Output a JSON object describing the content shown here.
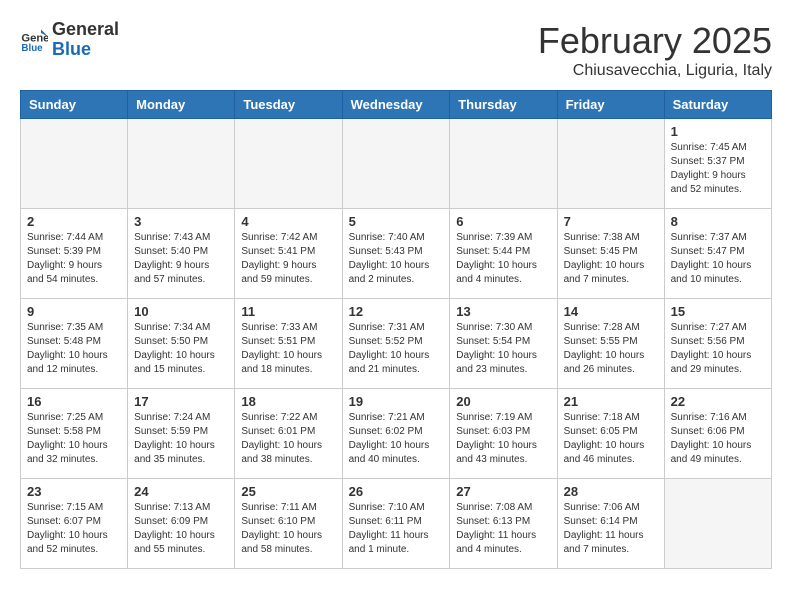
{
  "header": {
    "logo_line1": "General",
    "logo_line2": "Blue",
    "calendar_title": "February 2025",
    "calendar_subtitle": "Chiusavecchia, Liguria, Italy"
  },
  "weekdays": [
    "Sunday",
    "Monday",
    "Tuesday",
    "Wednesday",
    "Thursday",
    "Friday",
    "Saturday"
  ],
  "weeks": [
    [
      {
        "empty": true
      },
      {
        "empty": true
      },
      {
        "empty": true
      },
      {
        "empty": true
      },
      {
        "empty": true
      },
      {
        "empty": true
      },
      {
        "day": 1,
        "sunrise": "7:45 AM",
        "sunset": "5:37 PM",
        "daylight": "9 hours and 52 minutes."
      }
    ],
    [
      {
        "day": 2,
        "sunrise": "7:44 AM",
        "sunset": "5:39 PM",
        "daylight": "9 hours and 54 minutes."
      },
      {
        "day": 3,
        "sunrise": "7:43 AM",
        "sunset": "5:40 PM",
        "daylight": "9 hours and 57 minutes."
      },
      {
        "day": 4,
        "sunrise": "7:42 AM",
        "sunset": "5:41 PM",
        "daylight": "9 hours and 59 minutes."
      },
      {
        "day": 5,
        "sunrise": "7:40 AM",
        "sunset": "5:43 PM",
        "daylight": "10 hours and 2 minutes."
      },
      {
        "day": 6,
        "sunrise": "7:39 AM",
        "sunset": "5:44 PM",
        "daylight": "10 hours and 4 minutes."
      },
      {
        "day": 7,
        "sunrise": "7:38 AM",
        "sunset": "5:45 PM",
        "daylight": "10 hours and 7 minutes."
      },
      {
        "day": 8,
        "sunrise": "7:37 AM",
        "sunset": "5:47 PM",
        "daylight": "10 hours and 10 minutes."
      }
    ],
    [
      {
        "day": 9,
        "sunrise": "7:35 AM",
        "sunset": "5:48 PM",
        "daylight": "10 hours and 12 minutes."
      },
      {
        "day": 10,
        "sunrise": "7:34 AM",
        "sunset": "5:50 PM",
        "daylight": "10 hours and 15 minutes."
      },
      {
        "day": 11,
        "sunrise": "7:33 AM",
        "sunset": "5:51 PM",
        "daylight": "10 hours and 18 minutes."
      },
      {
        "day": 12,
        "sunrise": "7:31 AM",
        "sunset": "5:52 PM",
        "daylight": "10 hours and 21 minutes."
      },
      {
        "day": 13,
        "sunrise": "7:30 AM",
        "sunset": "5:54 PM",
        "daylight": "10 hours and 23 minutes."
      },
      {
        "day": 14,
        "sunrise": "7:28 AM",
        "sunset": "5:55 PM",
        "daylight": "10 hours and 26 minutes."
      },
      {
        "day": 15,
        "sunrise": "7:27 AM",
        "sunset": "5:56 PM",
        "daylight": "10 hours and 29 minutes."
      }
    ],
    [
      {
        "day": 16,
        "sunrise": "7:25 AM",
        "sunset": "5:58 PM",
        "daylight": "10 hours and 32 minutes."
      },
      {
        "day": 17,
        "sunrise": "7:24 AM",
        "sunset": "5:59 PM",
        "daylight": "10 hours and 35 minutes."
      },
      {
        "day": 18,
        "sunrise": "7:22 AM",
        "sunset": "6:01 PM",
        "daylight": "10 hours and 38 minutes."
      },
      {
        "day": 19,
        "sunrise": "7:21 AM",
        "sunset": "6:02 PM",
        "daylight": "10 hours and 40 minutes."
      },
      {
        "day": 20,
        "sunrise": "7:19 AM",
        "sunset": "6:03 PM",
        "daylight": "10 hours and 43 minutes."
      },
      {
        "day": 21,
        "sunrise": "7:18 AM",
        "sunset": "6:05 PM",
        "daylight": "10 hours and 46 minutes."
      },
      {
        "day": 22,
        "sunrise": "7:16 AM",
        "sunset": "6:06 PM",
        "daylight": "10 hours and 49 minutes."
      }
    ],
    [
      {
        "day": 23,
        "sunrise": "7:15 AM",
        "sunset": "6:07 PM",
        "daylight": "10 hours and 52 minutes."
      },
      {
        "day": 24,
        "sunrise": "7:13 AM",
        "sunset": "6:09 PM",
        "daylight": "10 hours and 55 minutes."
      },
      {
        "day": 25,
        "sunrise": "7:11 AM",
        "sunset": "6:10 PM",
        "daylight": "10 hours and 58 minutes."
      },
      {
        "day": 26,
        "sunrise": "7:10 AM",
        "sunset": "6:11 PM",
        "daylight": "11 hours and 1 minute."
      },
      {
        "day": 27,
        "sunrise": "7:08 AM",
        "sunset": "6:13 PM",
        "daylight": "11 hours and 4 minutes."
      },
      {
        "day": 28,
        "sunrise": "7:06 AM",
        "sunset": "6:14 PM",
        "daylight": "11 hours and 7 minutes."
      },
      {
        "empty": true
      }
    ]
  ]
}
